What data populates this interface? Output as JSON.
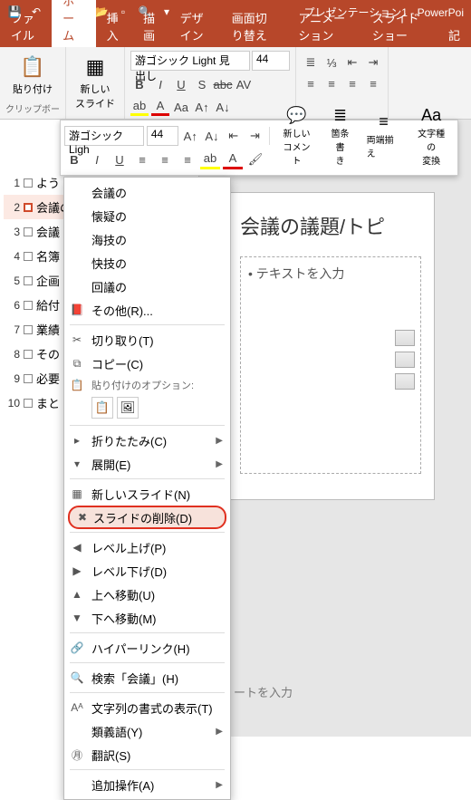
{
  "titlebar": {
    "title": "プレゼンテーション1 - PowerPoi"
  },
  "tabs": {
    "file": "ファイル",
    "home": "ホーム",
    "insert": "挿入",
    "draw": "描画",
    "design": "デザイン",
    "transitions": "画面切り替え",
    "animations": "アニメーション",
    "slideshow": "スライド ショー",
    "review": "記"
  },
  "ribbon": {
    "paste": "貼り付け",
    "clipboard": "クリップボー",
    "newslide": "新しい\nスライド",
    "font_name": "游ゴシック Light 見出し",
    "font_size": "44"
  },
  "mini": {
    "font_name": "游ゴシック Ligh",
    "font_size": "44",
    "comment": "新しい\nコメント",
    "vertical": "箇条書\nき",
    "justify": "両端揃え",
    "texttype": "文字種の\n変換"
  },
  "outline": {
    "items": [
      "よう",
      "会議の議題/トピック",
      "会議",
      "名簿",
      "企画",
      "給付",
      "業績",
      "その",
      "必要",
      "まと"
    ]
  },
  "slide": {
    "title": "会議の議題/トピ",
    "bullet": "• テキストを入力",
    "notes": "ートを入力"
  },
  "contextmenu": {
    "items": {
      "kaigi": "会議の",
      "kaigino": "懐疑の",
      "kaigi2": "海技の",
      "kaigi3": "快技の",
      "kaigi4": "回議の",
      "other": "その他(R)...",
      "cut": "切り取り(T)",
      "copy": "コピー(C)",
      "paste_label": "貼り付けのオプション:",
      "collapse": "折りたたみ(C)",
      "expand": "展開(E)",
      "newslide": "新しいスライド(N)",
      "deleteslide": "スライドの削除(D)",
      "promote": "レベル上げ(P)",
      "demote": "レベル下げ(D)",
      "moveup": "上へ移動(U)",
      "movedown": "下へ移動(M)",
      "hyperlink": "ハイパーリンク(H)",
      "search": "検索「会議」(H)",
      "textformat": "文字列の書式の表示(T)",
      "synonyms": "類義語(Y)",
      "translate": "翻訳(S)",
      "moreactions": "追加操作(A)"
    }
  }
}
